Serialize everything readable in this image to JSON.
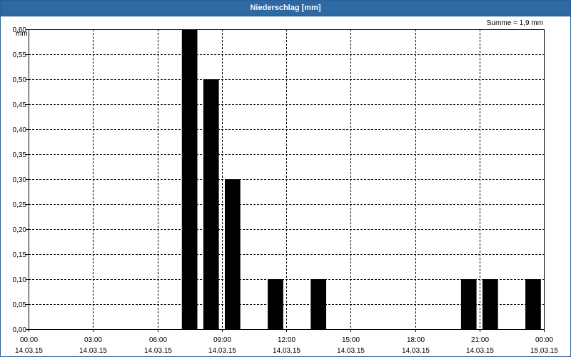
{
  "window": {
    "title": "Niederschlag [mm]"
  },
  "summary": {
    "text": "Summe = 1,9 mm"
  },
  "chart_data": {
    "type": "bar",
    "title": "Niederschlag [mm]",
    "ylabel": "mm",
    "xlabel": "",
    "ylim": [
      0,
      0.6
    ],
    "yticks": [
      "0,00",
      "0,05",
      "0,10",
      "0,15",
      "0,20",
      "0,25",
      "0,30",
      "0,35",
      "0,40",
      "0,45",
      "0,50",
      "0,55",
      "0,60"
    ],
    "xlim_hours": [
      0,
      24
    ],
    "xticks": [
      {
        "time": "00:00",
        "date": "14.03.15",
        "hour": 0
      },
      {
        "time": "03:00",
        "date": "14.03.15",
        "hour": 3
      },
      {
        "time": "06:00",
        "date": "14.03.15",
        "hour": 6
      },
      {
        "time": "09:00",
        "date": "14.03.15",
        "hour": 9
      },
      {
        "time": "12:00",
        "date": "14.03.15",
        "hour": 12
      },
      {
        "time": "15:00",
        "date": "14.03.15",
        "hour": 15
      },
      {
        "time": "18:00",
        "date": "14.03.15",
        "hour": 18
      },
      {
        "time": "21:00",
        "date": "14.03.15",
        "hour": 21
      },
      {
        "time": "00:00",
        "date": "15.03.15",
        "hour": 24
      }
    ],
    "grid": true,
    "bars": [
      {
        "hour": 7.5,
        "value": 0.6
      },
      {
        "hour": 8.5,
        "value": 0.5
      },
      {
        "hour": 9.5,
        "value": 0.3
      },
      {
        "hour": 11.5,
        "value": 0.1
      },
      {
        "hour": 13.5,
        "value": 0.1
      },
      {
        "hour": 20.5,
        "value": 0.1
      },
      {
        "hour": 21.5,
        "value": 0.1
      },
      {
        "hour": 23.5,
        "value": 0.1
      }
    ],
    "bar_color": "#000000"
  }
}
